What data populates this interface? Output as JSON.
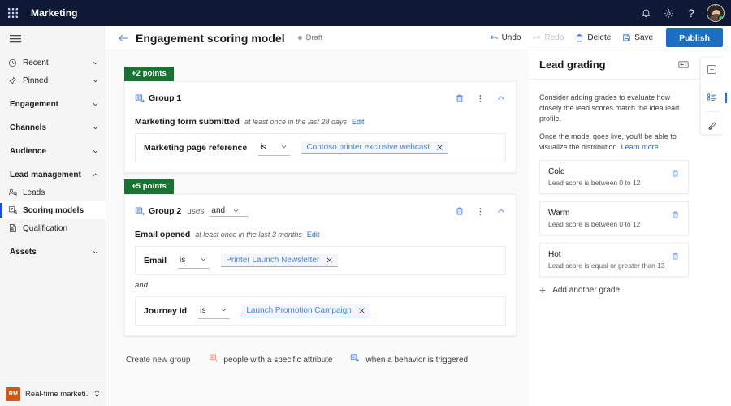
{
  "topbar": {
    "waffle_icon": "app-launcher-icon",
    "brand": "Marketing",
    "icons": [
      {
        "name": "notification-bell-icon",
        "glyph": "bell"
      },
      {
        "name": "settings-gear-icon",
        "glyph": "gear"
      },
      {
        "name": "help-question-icon",
        "glyph": "?"
      }
    ],
    "avatar_name": "user-avatar",
    "presence": "available"
  },
  "sidebar": {
    "hamburger_icon": "hamburger-menu-icon",
    "items": [
      {
        "label": "Recent",
        "icon": "clock-icon",
        "type": "link",
        "chevron": "down"
      },
      {
        "label": "Pinned",
        "icon": "pin-icon",
        "type": "link",
        "chevron": "down"
      },
      {
        "label": "Engagement",
        "icon": "",
        "type": "section",
        "chevron": "down"
      },
      {
        "label": "Channels",
        "icon": "",
        "type": "section",
        "chevron": "down"
      },
      {
        "label": "Audience",
        "icon": "",
        "type": "section",
        "chevron": "down"
      },
      {
        "label": "Lead management",
        "icon": "",
        "type": "section",
        "chevron": "up"
      },
      {
        "label": "Leads",
        "icon": "leads-icon",
        "type": "child",
        "chevron": ""
      },
      {
        "label": "Scoring models",
        "icon": "scoring-icon",
        "type": "child",
        "chevron": "",
        "selected": true
      },
      {
        "label": "Qualification",
        "icon": "qualify-icon",
        "type": "child",
        "chevron": ""
      },
      {
        "label": "Assets",
        "icon": "",
        "type": "section",
        "chevron": "down"
      }
    ],
    "app_switcher": {
      "badge": "RM",
      "label": "Real-time marketi…",
      "icon": "app-switcher-icon"
    }
  },
  "commandbar": {
    "back_icon": "back-arrow-icon",
    "title": "Engagement scoring model",
    "status": "Draft",
    "buttons": [
      {
        "label": "Undo",
        "icon": "undo-icon",
        "disabled": false
      },
      {
        "label": "Redo",
        "icon": "redo-icon",
        "disabled": true
      },
      {
        "label": "Delete",
        "icon": "delete-icon",
        "disabled": false
      },
      {
        "label": "Save",
        "icon": "save-icon",
        "disabled": false
      }
    ],
    "publish_label": "Publish",
    "publish_color": "#1b6ec2"
  },
  "canvas": {
    "groups": [
      {
        "points": "+2 points",
        "name": "Group 1",
        "uses_label": "",
        "logic_operator": "",
        "group_icon": "condition-group-icon",
        "actions": [
          "delete-icon",
          "more-options-icon",
          "collapse-chevron-icon"
        ],
        "trigger": {
          "name": "Marketing form submitted",
          "frequency": "at least once in the last 28 days",
          "edit_label": "Edit"
        },
        "conditions": [
          {
            "attribute": "Marketing page reference",
            "operator": "is",
            "value": "Contoso printer exclusive webcast",
            "focused": false
          }
        ],
        "separators": []
      },
      {
        "points": "+5 points",
        "name": "Group 2",
        "uses_label": "uses",
        "logic_operator": "and",
        "group_icon": "condition-group-icon",
        "actions": [
          "delete-icon",
          "more-options-icon",
          "collapse-chevron-icon"
        ],
        "trigger": {
          "name": "Email opened",
          "frequency": "at least once in the last 3 months",
          "edit_label": "Edit"
        },
        "conditions": [
          {
            "attribute": "Email",
            "operator": "is",
            "value": "Printer Launch Newsletter",
            "focused": false
          },
          {
            "attribute": "Journey Id",
            "operator": "is",
            "value": "Launch Promotion Campaign",
            "focused": true
          }
        ],
        "separators": [
          "and"
        ]
      }
    ],
    "new_group": {
      "label": "Create new group",
      "options": [
        {
          "label": "people with a specific attribute",
          "icon": "attribute-group-icon"
        },
        {
          "label": "when a behavior is triggered",
          "icon": "behavior-group-icon"
        }
      ]
    }
  },
  "right_panel": {
    "title": "Lead grading",
    "collapse_icon": "collapse-panel-icon",
    "paragraphs": [
      "Consider adding grades to evaluate how closely the lead scores match the idea lead profile.",
      "Once the model goes live, you'll be able to visualize the distribution."
    ],
    "learn_more": "Learn more",
    "grades": [
      {
        "name": "Cold",
        "desc": "Lead score is between 0 to 12",
        "delete_icon": "delete-icon"
      },
      {
        "name": "Warm",
        "desc": "Lead score is between 0 to 12",
        "delete_icon": "delete-icon"
      },
      {
        "name": "Hot",
        "desc": "Lead score is equal or greater than 13",
        "delete_icon": "delete-icon"
      }
    ],
    "add_grade_label": "Add another grade"
  },
  "rail": {
    "buttons": [
      {
        "name": "add-panel-icon",
        "active": false
      },
      {
        "name": "lead-grading-icon",
        "active": true
      },
      {
        "name": "settings-pen-icon",
        "active": false
      }
    ]
  }
}
